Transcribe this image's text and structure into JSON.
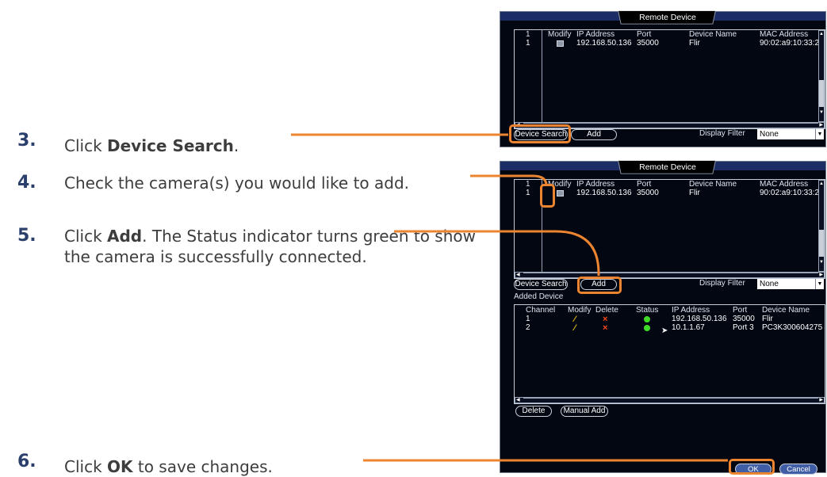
{
  "steps": [
    {
      "num": "3.",
      "pre": "Click ",
      "bold": "Device Search",
      "post": "."
    },
    {
      "num": "4.",
      "text": "Check the camera(s) you would like to add."
    },
    {
      "num": "5.",
      "pre": "Click ",
      "bold": "Add",
      "post": ". The Status indicator turns green to show the camera is successfully connected."
    },
    {
      "num": "6.",
      "pre": "Click ",
      "bold": "OK",
      "post": " to save changes."
    }
  ],
  "screen": {
    "title": "Remote Device",
    "search_columns": [
      "1",
      "Modify",
      "IP Address",
      "Port",
      "Device Name",
      "MAC Address"
    ],
    "search_rows": [
      {
        "num": "1",
        "ip": "192.168.50.136",
        "port": "35000",
        "name": "Flir",
        "mac": "90:02:a9:10:33:2!"
      }
    ],
    "device_search_label": "Device Search",
    "add_label": "Add",
    "display_filter_label": "Display Filter",
    "display_filter_value": "None",
    "added_device_label": "Added Device",
    "added_columns": [
      "Channel",
      "Modify",
      "Delete",
      "Status",
      "IP Address",
      "Port",
      "Device Name"
    ],
    "added_rows": [
      {
        "channel": "1",
        "ip": "192.168.50.136",
        "port": "35000",
        "name": "Flir",
        "status_color": "#3fdc27"
      },
      {
        "channel": "2",
        "ip": "10.1.1.67",
        "port": "Port 3",
        "name": "PC3K300604275",
        "status_color": "#3fdc27"
      }
    ],
    "delete_label": "Delete",
    "manual_add_label": "Manual Add",
    "ok_label": "OK",
    "cancel_label": "Cancel"
  },
  "colors": {
    "accent_orange": "#ed8530",
    "step_number": "#2a3f6b",
    "screen_bg": "#020712",
    "title_bar": "#1b2d64"
  }
}
